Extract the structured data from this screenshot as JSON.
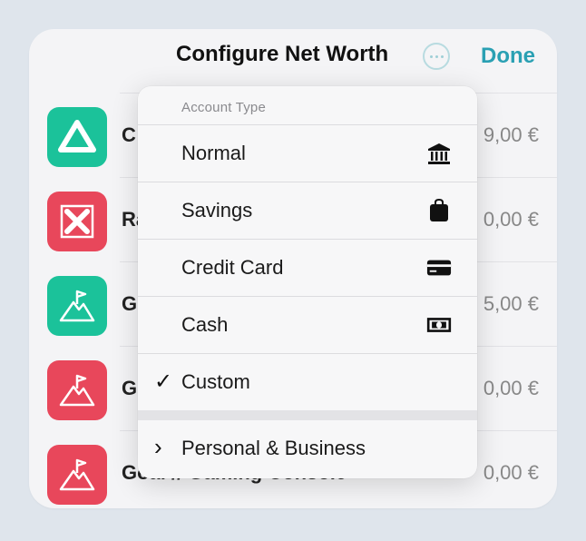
{
  "header": {
    "title": "Configure Net Worth",
    "done_label": "Done"
  },
  "colors": {
    "accent": "#2aa0b3",
    "green_icon": "#1bc29a",
    "red_icon": "#e8475b"
  },
  "rows": [
    {
      "name": "C",
      "value": "9,00 €",
      "icon": "drive-triangle-icon"
    },
    {
      "name": "Ra",
      "value": "0,00 €",
      "icon": "raiffeisen-cross-icon"
    },
    {
      "name": "G",
      "value": "5,00 €",
      "icon": "mountain-flag-icon"
    },
    {
      "name": "G",
      "value": "0,00 €",
      "icon": "mountain-flag-icon"
    },
    {
      "name": "Goal // Gaming Console",
      "value": "0,00 €",
      "icon": "mountain-flag-icon"
    }
  ],
  "menu": {
    "header": "Account Type",
    "items": [
      {
        "label": "Normal",
        "icon": "bank-icon"
      },
      {
        "label": "Savings",
        "icon": "bag-icon"
      },
      {
        "label": "Credit Card",
        "icon": "credit-card-icon"
      },
      {
        "label": "Cash",
        "icon": "banknote-icon"
      },
      {
        "label": "Custom",
        "check": "✓",
        "selected": true
      }
    ],
    "submenu": {
      "label": "Personal & Business",
      "chevron": "›"
    }
  }
}
